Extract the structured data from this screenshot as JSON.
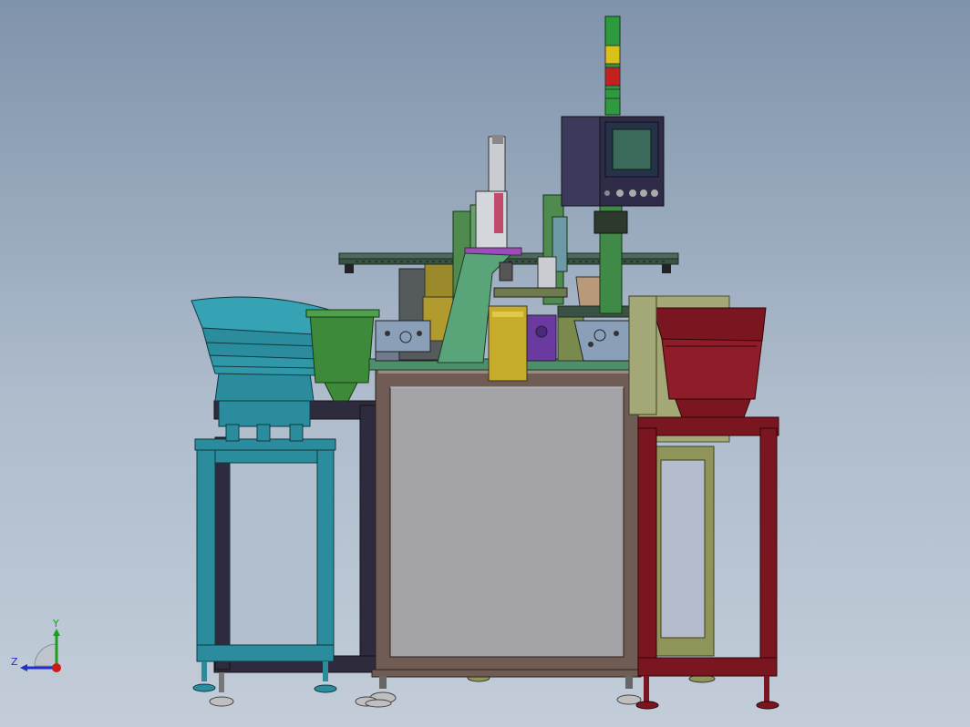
{
  "colors": {
    "feeder_left": "#2a8c9c",
    "feeder_right": "#7a1620",
    "frame_main": "#6f5c54",
    "panel_gray": "#a3a3a8",
    "hopper_green": "#3d8a3a",
    "stack_light_green": "#2e9a3e",
    "stack_light_yellow": "#d8c21a",
    "stack_light_red": "#c42020",
    "control_box": "#3c3a5a",
    "olive": "#8f9558",
    "dark_frame": "#2e2b3e"
  },
  "triad": {
    "y_axis_label": "Y",
    "z_axis_label": "Z"
  }
}
